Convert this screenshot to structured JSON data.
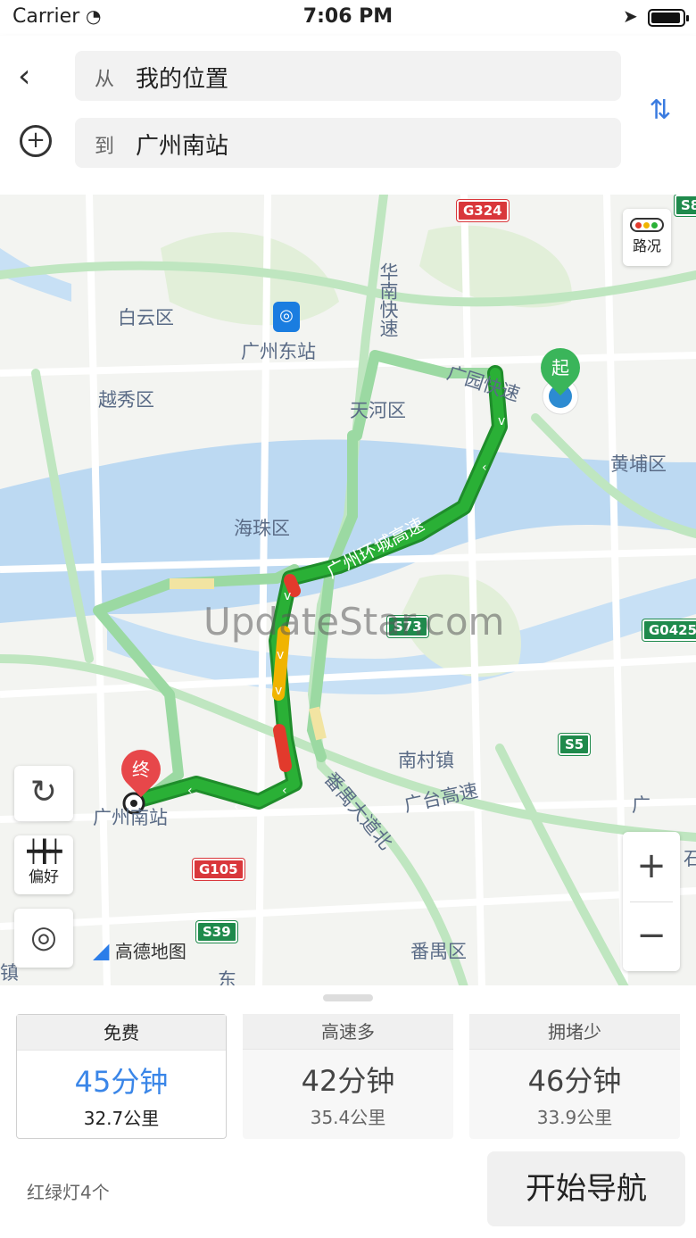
{
  "status": {
    "carrier": "Carrier",
    "time": "7:06 PM"
  },
  "search": {
    "from_prefix": "从",
    "from_value": "我的位置",
    "to_prefix": "到",
    "to_value": "广州南站"
  },
  "map": {
    "traffic_label": "路况",
    "pref_label": "偏好",
    "start_pin": "起",
    "end_pin": "终",
    "logo": "高德地图",
    "watermark": "UpdateStar.com",
    "labels": {
      "baiyun": "白云区",
      "yuexiu": "越秀区",
      "gz_east": "广州东站",
      "tianhe": "天河区",
      "huangpu": "黄埔区",
      "haizhu": "海珠区",
      "nancun": "南村镇",
      "panyu": "番禺区",
      "gz_south": "广州南站",
      "huanan": "华南快速",
      "guangyuan": "广园快速",
      "huancheng": "广州环城高速",
      "panyu_ave": "番禺大道北",
      "guangtai": "广台高速",
      "dong": "东",
      "guang": "广",
      "shi": "石",
      "zhen": "镇"
    },
    "badges": {
      "g324": "G324",
      "s8": "S8",
      "s73": "S73",
      "g0425": "G0425",
      "s5": "S5",
      "g105": "G105",
      "s39": "S39"
    }
  },
  "routes": [
    {
      "tag": "免费",
      "duration": "45分钟",
      "distance": "32.7公里",
      "selected": true
    },
    {
      "tag": "高速多",
      "duration": "42分钟",
      "distance": "35.4公里",
      "selected": false
    },
    {
      "tag": "拥堵少",
      "duration": "46分钟",
      "distance": "33.9公里",
      "selected": false
    }
  ],
  "footer": {
    "lights": "红绿灯4个",
    "start_nav": "开始导航"
  },
  "colors": {
    "accent": "#3a86e8",
    "route_green": "#22a52c",
    "jam_red": "#e23a2c",
    "slow_yellow": "#f0b400"
  }
}
